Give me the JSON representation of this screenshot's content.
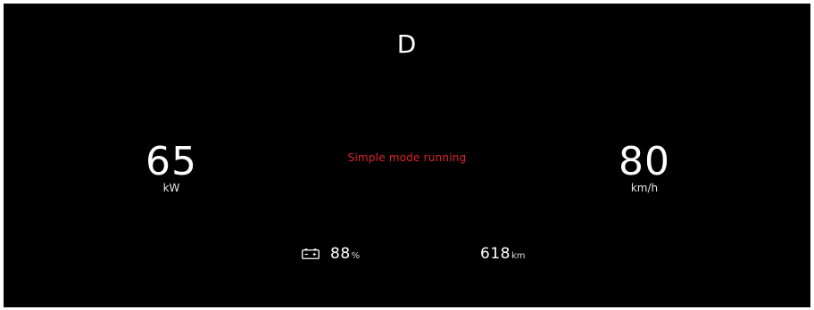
{
  "gear": "D",
  "power": {
    "value": "65",
    "unit": "kW"
  },
  "speed": {
    "value": "80",
    "unit": "km/h"
  },
  "status": {
    "text": "Simple mode running",
    "color": "#e0222a"
  },
  "battery": {
    "icon": "battery-icon",
    "value": "88",
    "unit": "%"
  },
  "range": {
    "value": "618",
    "unit": "km"
  },
  "colors": {
    "background": "#000000",
    "text": "#ffffff",
    "frame": "#ffffff"
  }
}
